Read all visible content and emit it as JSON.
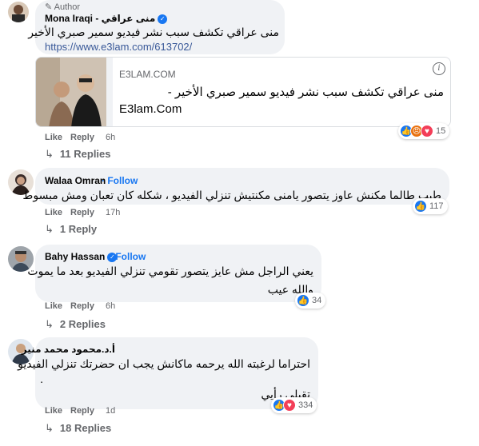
{
  "comments": [
    {
      "author_tag": "Author",
      "name": "Mona Iraqi - منى عراقي",
      "text": "منى عراقي تكشف سبب نشر فيديو سمير صبري الأخير",
      "link": "https://www.e3lam.com/613702/",
      "card": {
        "domain": "E3LAM.COM",
        "title": "منى عراقي تكشف سبب نشر فيديو سمير صبري الأخير -",
        "subtitle": "E3lam.Com",
        "info_icon": "i"
      },
      "actions": {
        "like": "Like",
        "reply": "Reply",
        "time": "6h"
      },
      "reactions": {
        "icons": [
          "like-icon",
          "angry-icon",
          "love-icon"
        ],
        "count": "15"
      },
      "replies_label": "11 Replies"
    },
    {
      "name": "Walaa Omran",
      "follow": "Follow",
      "text": "طيب طالما مكنش عاوز يتصور يامنى مكنتيش تنزلي الفيديو ، شكله كان تعبان ومش مبسوط",
      "actions": {
        "like": "Like",
        "reply": "Reply",
        "time": "17h"
      },
      "reactions": {
        "icons": [
          "like-icon"
        ],
        "count": "117"
      },
      "replies_label": "1 Reply"
    },
    {
      "name": "Bahy Hassan",
      "follow": "Follow",
      "text_lines": [
        "يعني الراجل مش عايز يتصور تقومي تنزلي الفيديو بعد ما يموت",
        "والله عيب"
      ],
      "actions": {
        "like": "Like",
        "reply": "Reply",
        "time": "6h"
      },
      "reactions": {
        "icons": [
          "like-icon"
        ],
        "count": "34"
      },
      "replies_label": "2 Replies"
    },
    {
      "name": "أ.د.محمود محمد منير",
      "text_lines": [
        "احتراما لرغبته الله يرحمه ماكانش يجب ان حضرتك تنزلي الفيديو",
        ".",
        "تقبلي رأيي"
      ],
      "actions": {
        "like": "Like",
        "reply": "Reply",
        "time": "1d"
      },
      "reactions": {
        "icons": [
          "like-icon",
          "love-icon"
        ],
        "count": "334"
      },
      "replies_label": "18 Replies"
    }
  ],
  "colors": {
    "accent": "#1877f2",
    "bubble": "#f0f2f5",
    "meta": "#65676b",
    "link": "#385898"
  }
}
